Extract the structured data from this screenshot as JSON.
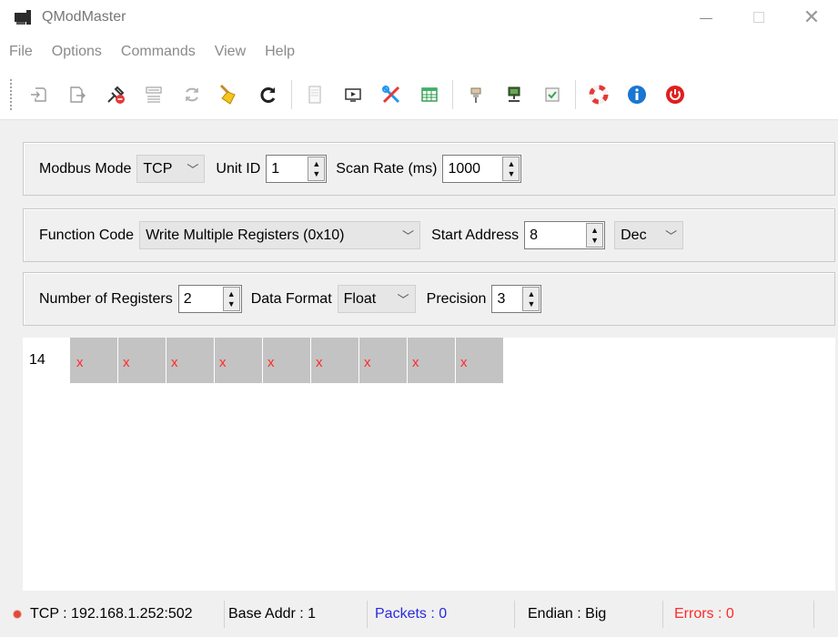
{
  "window": {
    "title": "QModMaster"
  },
  "menu": [
    "File",
    "Options",
    "Commands",
    "View",
    "Help"
  ],
  "toolbar": {
    "icons": [
      "connect-icon",
      "disconnect-icon",
      "reset-counters-icon",
      "bus-monitor-icon",
      "scan-icon",
      "clear-icon",
      "refresh-icon",
      "log-icon",
      "tools-icon",
      "settings-icon",
      "table-icon",
      "serial-port-icon",
      "network-icon",
      "checkbox-icon",
      "help-icon",
      "info-icon",
      "exit-icon"
    ]
  },
  "mode_group": {
    "modbus_mode_label": "Modbus Mode",
    "modbus_mode_value": "TCP",
    "unit_id_label": "Unit ID",
    "unit_id_value": "1",
    "scan_rate_label": "Scan Rate (ms)",
    "scan_rate_value": "1000"
  },
  "function_group": {
    "function_code_label": "Function Code",
    "function_code_value": "Write Multiple Registers (0x10)",
    "start_address_label": "Start Address",
    "start_address_value": "8",
    "address_format_value": "Dec"
  },
  "register_group": {
    "number_registers_label": "Number of Registers",
    "number_registers_value": "2",
    "data_format_label": "Data Format",
    "data_format_value": "Float",
    "precision_label": "Precision",
    "precision_value": "3"
  },
  "data_table": {
    "row_header": "14",
    "cells": [
      "x",
      "x",
      "x",
      "x",
      "x",
      "x",
      "x",
      "x",
      "x"
    ]
  },
  "status": {
    "connection": "TCP : 192.168.1.252:502",
    "base_addr": "Base Addr : 1",
    "packets": "Packets : 0",
    "endian": "Endian : Big",
    "errors": "Errors : 0"
  }
}
